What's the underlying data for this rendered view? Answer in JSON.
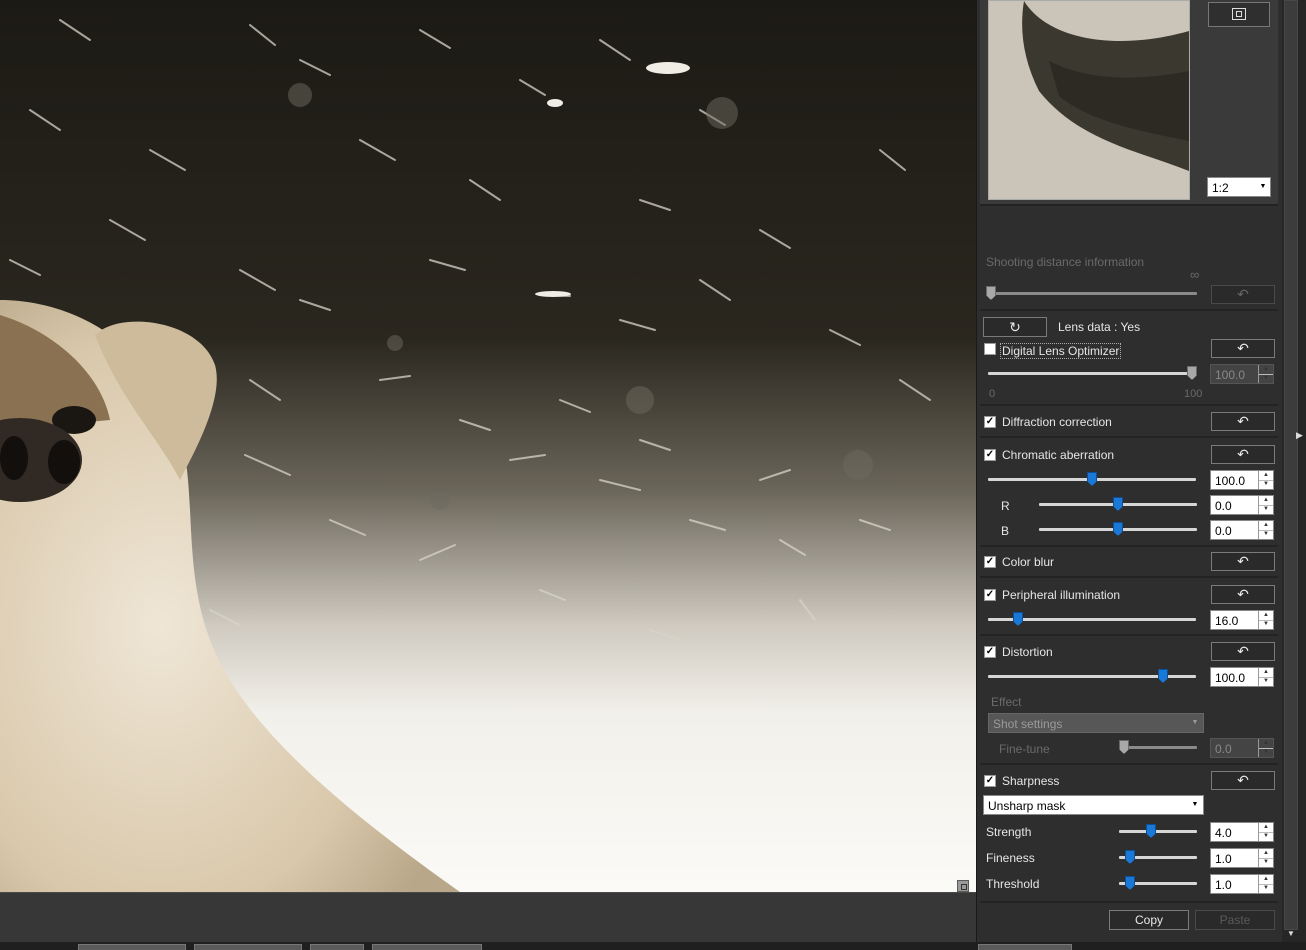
{
  "navigator": {
    "zoom": "1:2"
  },
  "lens": {
    "shooting_distance_label": "Shooting distance information",
    "infinity_symbol": "∞",
    "lens_data_label": "Lens data : Yes",
    "dlo_label": "Digital Lens Optimizer",
    "dlo_value": "100.0",
    "dlo_min": "0",
    "dlo_max": "100",
    "diffraction_label": "Diffraction correction",
    "chromatic_label": "Chromatic aberration",
    "chromatic_value": "100.0",
    "r_label": "R",
    "r_value": "0.0",
    "b_label": "B",
    "b_value": "0.0",
    "color_blur_label": "Color blur",
    "peripheral_label": "Peripheral illumination",
    "peripheral_value": "16.0",
    "distortion_label": "Distortion",
    "distortion_value": "100.0",
    "effect_label": "Effect",
    "effect_value": "Shot settings",
    "finetune_label": "Fine-tune",
    "finetune_value": "0.0"
  },
  "sharpness": {
    "label": "Sharpness",
    "mode": "Unsharp mask",
    "strength_label": "Strength",
    "strength_value": "4.0",
    "fineness_label": "Fineness",
    "fineness_value": "1.0",
    "threshold_label": "Threshold",
    "threshold_value": "1.0"
  },
  "footer": {
    "copy_label": "Copy",
    "paste_label": "Paste"
  },
  "icons": {
    "reset": "↶",
    "refresh": "↻",
    "check": "✓",
    "dropdown_arrow": "▼",
    "spin_up": "▲",
    "spin_down": "▼"
  }
}
